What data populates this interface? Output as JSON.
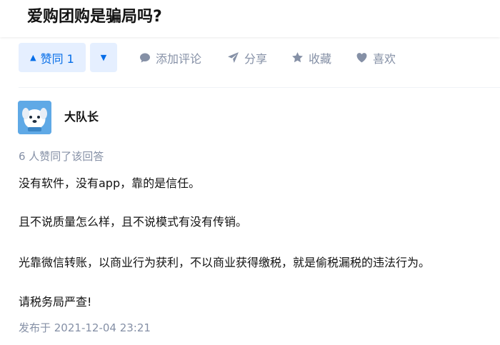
{
  "question": {
    "title": "爱购团购是骗局吗?"
  },
  "actions": {
    "vote_up_label": "赞同 1",
    "comment_label": "添加评论",
    "share_label": "分享",
    "favorite_label": "收藏",
    "like_label": "喜欢"
  },
  "answer": {
    "author_name": "大队长",
    "vote_count_text": "6 人赞同了该回答",
    "paragraphs": [
      "没有软件，没有app，靠的是信任。",
      "且不说质量怎么样，且不说模式有没有传销。",
      "光靠微信转账，以商业行为获利，不以商业获得缴税，就是偷税漏税的违法行为。",
      "请税务局严查!"
    ],
    "publish_time": "发布于 2021-12-04 23:21"
  },
  "icons": {
    "vote_up": "triangle-up-icon",
    "vote_down": "triangle-down-icon",
    "comment": "comment-bubble-icon",
    "share": "paper-plane-icon",
    "favorite": "star-icon",
    "like": "heart-icon",
    "avatar": "dog-avatar-icon"
  },
  "colors": {
    "accent": "#056de8",
    "accent_bg": "#e5efff",
    "muted": "#8590a6",
    "text": "#121212"
  }
}
